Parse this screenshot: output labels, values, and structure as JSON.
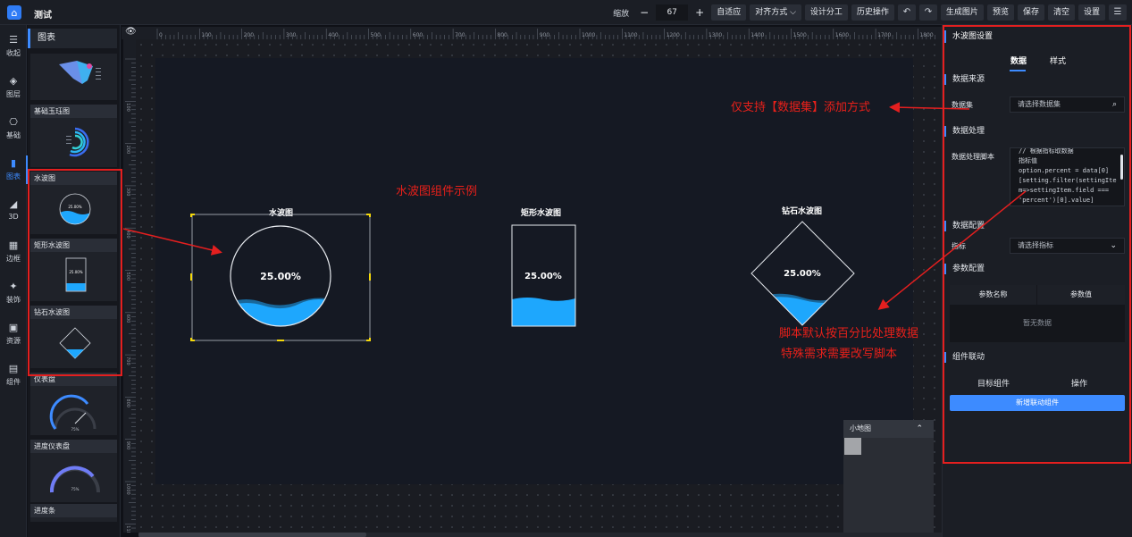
{
  "app": {
    "title": "测试",
    "logo_icon": "home-icon"
  },
  "toolbar": {
    "zoom_label": "缩放",
    "zoom_minus": "−",
    "zoom_value": "67",
    "zoom_plus": "+",
    "fit": "自适应",
    "align": "对齐方式 ⌵",
    "distribute": "设计分工",
    "history": "历史操作",
    "undo": "↶",
    "redo": "↷",
    "gen_image": "生成图片",
    "preview": "预览",
    "save": "保存",
    "clear": "清空",
    "settings": "设置",
    "more": "☰"
  },
  "nav": [
    {
      "icon": "☰",
      "label": "收起"
    },
    {
      "icon": "◈",
      "label": "图层"
    },
    {
      "icon": "⎔",
      "label": "基础"
    },
    {
      "icon": "▮",
      "label": "图表"
    },
    {
      "icon": "◢",
      "label": "3D"
    },
    {
      "icon": "▦",
      "label": "边框"
    },
    {
      "icon": "✦",
      "label": "装饰"
    },
    {
      "icon": "▣",
      "label": "资源"
    },
    {
      "icon": "▤",
      "label": "组件"
    }
  ],
  "library": {
    "header": "图表",
    "cards": [
      {
        "title": ""
      },
      {
        "title": "基础玉珏图"
      },
      {
        "title": "水波图",
        "value": "25.00%"
      },
      {
        "title": "矩形水波图",
        "value": "25.00%"
      },
      {
        "title": "钻石水波图"
      },
      {
        "title": "仪表盘",
        "value": "75%"
      },
      {
        "title": "进度仪表盘",
        "value": "75%"
      },
      {
        "title": "进度条"
      }
    ]
  },
  "ruler": {
    "marks": [
      "0",
      "100",
      "200",
      "300",
      "400",
      "500",
      "600",
      "700",
      "800",
      "900",
      "1000",
      "1100",
      "1200",
      "1300",
      "1400",
      "1500",
      "1600",
      "1700",
      "1800",
      "1900"
    ],
    "left_marks": [
      "100",
      "200",
      "300",
      "400",
      "500",
      "600",
      "700",
      "800",
      "900",
      "1000",
      "1100"
    ],
    "eye_icon": "👁"
  },
  "canvas": {
    "wave_circle": {
      "title": "水波图",
      "value": "25.00%",
      "level": 0.25
    },
    "wave_rect": {
      "title": "矩形水波图",
      "value": "25.00%",
      "level": 0.25
    },
    "wave_diamond": {
      "title": "钻石水波图",
      "value": "25.00%",
      "level": 0.25
    },
    "minimap": {
      "title": "小地图",
      "chevron": "⌃"
    }
  },
  "annotations": {
    "example": "水波图组件示例",
    "dataset_only": "仅支持【数据集】添加方式",
    "script_line1": "脚本默认按百分比处理数据",
    "script_line2": "特殊需求需要改写脚本"
  },
  "panel": {
    "title": "水波图设置",
    "tabs": [
      "数据",
      "样式"
    ],
    "source_section": "数据来源",
    "dataset_label": "数据集",
    "dataset_placeholder": "请选择数据集",
    "search_icon": "⌕",
    "process_section": "数据处理",
    "script_label": "数据处理脚本",
    "script_code": "// 根据指标取数据\n指标值\noption.percent = data[0]\n[setting.filter(settingIte\nm=>settingItem.field ===\n'percent')[0].value]",
    "config_section": "数据配置",
    "metric_label": "指标",
    "metric_placeholder": "请选择指标",
    "chevron": "⌄",
    "param_section": "参数配置",
    "param_cols": [
      "参数名称",
      "参数值"
    ],
    "param_empty": "暂无数据",
    "link_section": "组件联动",
    "link_cols": [
      "目标组件",
      "操作"
    ],
    "add_link": "新增联动组件"
  },
  "colors": {
    "accent": "#3d8bff",
    "wave": "#1ea7fd",
    "annotation": "#e8201a"
  }
}
